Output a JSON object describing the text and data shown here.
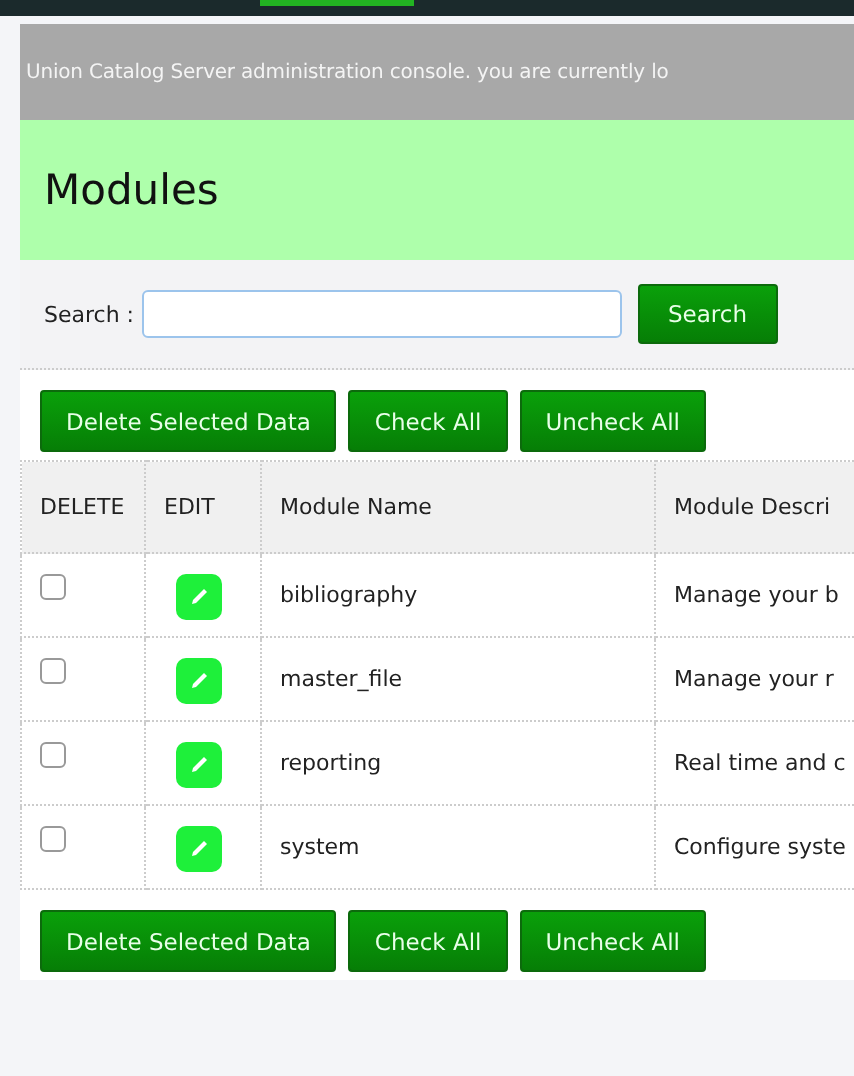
{
  "banner": {
    "text": "Union Catalog Server administration console. you are currently lo"
  },
  "header": {
    "title": "Modules"
  },
  "search": {
    "label": "Search :",
    "button": "Search"
  },
  "actions_top": [
    "Delete Selected Data",
    "Check All",
    "Uncheck All"
  ],
  "table": {
    "columns": [
      "DELETE",
      "EDIT",
      "Module Name",
      "Module Descri"
    ],
    "rows": [
      {
        "checked": false,
        "name": "bibliography",
        "description": "Manage your b"
      },
      {
        "checked": false,
        "name": "master_file",
        "description": "Manage your r"
      },
      {
        "checked": false,
        "name": "reporting",
        "description": "Real time and c"
      },
      {
        "checked": false,
        "name": "system",
        "description": "Configure syste"
      }
    ]
  },
  "actions_bottom": [
    "Delete Selected Data",
    "Check All",
    "Uncheck All"
  ]
}
